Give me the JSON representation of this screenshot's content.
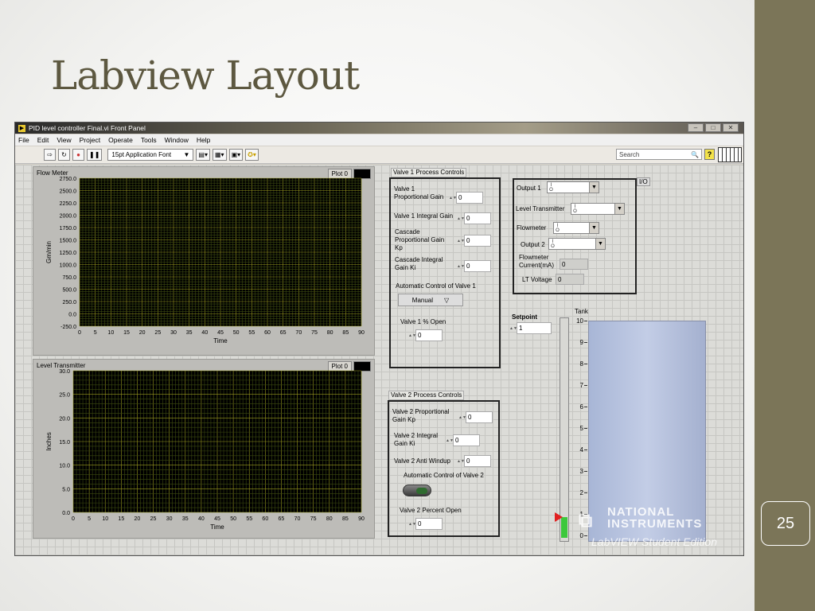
{
  "slide": {
    "title": "Labview Layout",
    "page_number": "25"
  },
  "window": {
    "title": "PID level controller Final.vi Front Panel",
    "controls": [
      "–",
      "□",
      "✕"
    ],
    "menu": [
      "File",
      "Edit",
      "View",
      "Project",
      "Operate",
      "Tools",
      "Window",
      "Help"
    ],
    "font_select": "15pt Application Font",
    "search_placeholder": "Search"
  },
  "flow_meter": {
    "title": "Flow Meter",
    "plot_label": "Plot 0",
    "ylabel": "Gm/min",
    "xlabel": "Time",
    "y_ticks": [
      "2750.0",
      "2500.0",
      "2250.0",
      "2000.0",
      "1750.0",
      "1500.0",
      "1250.0",
      "1000.0",
      "750.0",
      "500.0",
      "250.0",
      "0.0",
      "-250.0"
    ],
    "x_ticks": [
      "0",
      "5",
      "10",
      "15",
      "20",
      "25",
      "30",
      "35",
      "40",
      "45",
      "50",
      "55",
      "60",
      "65",
      "70",
      "75",
      "80",
      "85",
      "90"
    ]
  },
  "level_transmitter_chart": {
    "title": "Level Transmitter",
    "plot_label": "Plot 0",
    "ylabel": "Inches",
    "xlabel": "Time",
    "y_ticks": [
      "30.0",
      "25.0",
      "20.0",
      "15.0",
      "10.0",
      "5.0",
      "0.0"
    ],
    "x_ticks": [
      "0",
      "5",
      "10",
      "15",
      "20",
      "25",
      "30",
      "35",
      "40",
      "45",
      "50",
      "55",
      "60",
      "65",
      "70",
      "75",
      "80",
      "85",
      "90"
    ]
  },
  "valve1": {
    "section": "Valve 1 Process Controls",
    "prop_gain_label": "Valve 1 Proportional Gain",
    "prop_gain": "0",
    "integral_gain_label": "Valve 1 Integral Gain",
    "integral_gain": "0",
    "cascade_kp_label": "Cascade Proportional Gain Kp",
    "cascade_kp": "0",
    "cascade_ki_label": "Cascade Integral Gain Ki",
    "cascade_ki": "0",
    "auto_label": "Automatic Control of  Valve 1",
    "mode": "Manual",
    "open_label": "Valve 1 % Open",
    "open": "0"
  },
  "valve2": {
    "section": "Valve 2 Process Controls",
    "kp_label": "Valve 2 Proportional Gain Kp",
    "kp": "0",
    "ki_label": "Valve 2 Integral Gain Ki",
    "ki": "0",
    "windup_label": "Valve 2 Anti Windup",
    "windup": "0",
    "auto_label": "Automatic Control of Valve 2",
    "open_label": "Valve 2 Percent Open",
    "open": "0"
  },
  "io": {
    "tag": "I/O",
    "output1_label": "Output 1",
    "level_tx_label": "Level Transmitter",
    "flowmeter_label": "Flowmeter",
    "output2_label": "Output 2",
    "current_label": "Flowmeter Current(mA)",
    "current": "0",
    "lt_voltage_label": "LT Voltage",
    "lt_voltage": "0"
  },
  "setpoint": {
    "label": "Setpoint",
    "value": "1"
  },
  "tank": {
    "label": "Tank",
    "ticks": [
      "10",
      "9",
      "8",
      "7",
      "6",
      "5",
      "4",
      "3",
      "2",
      "1",
      "0"
    ],
    "level": 0
  },
  "watermark": {
    "line1": "NATIONAL",
    "line2": "INSTRUMENTS",
    "line3": "LabVIEW Student Edition"
  }
}
